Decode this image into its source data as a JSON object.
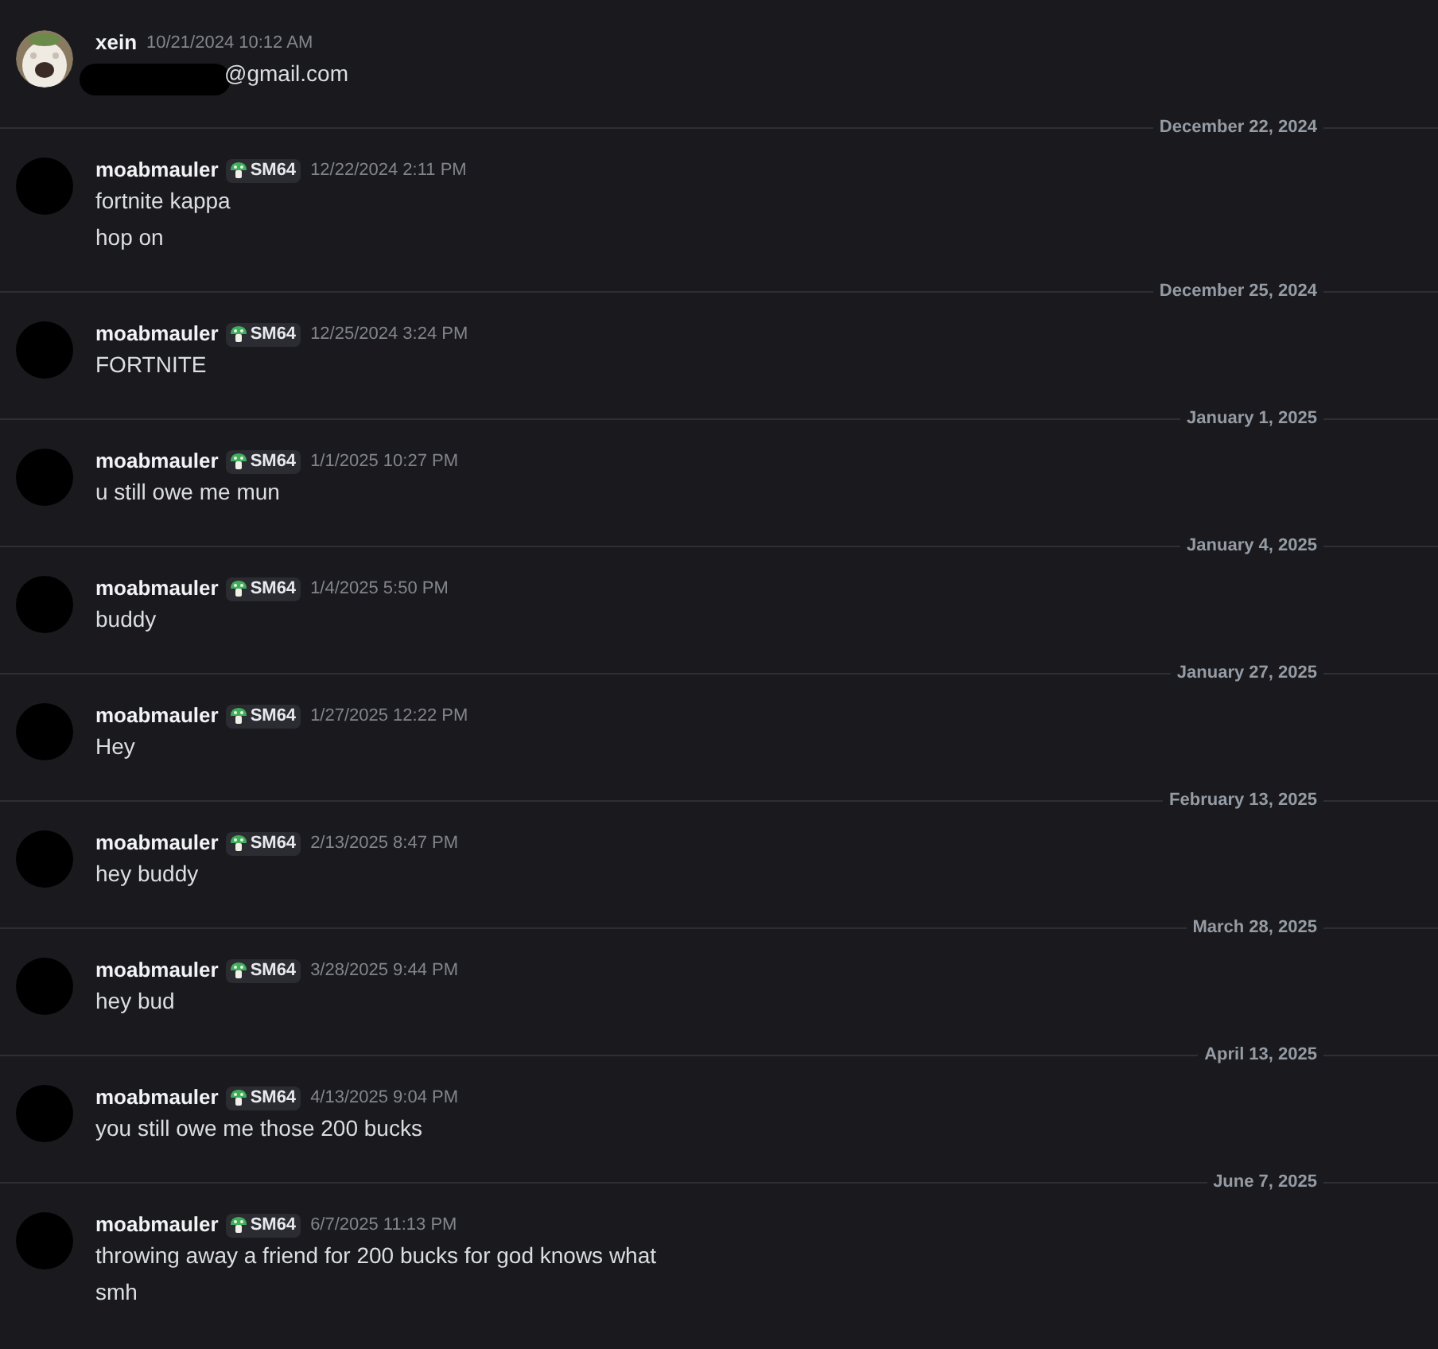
{
  "messages": [
    {
      "author": "xein",
      "avatar": {
        "kind": "picture"
      },
      "timestamp": "10/21/2024 10:12 AM",
      "redacted": true,
      "lines": [
        "@gmail.com"
      ]
    },
    {
      "date_divider": "December 22, 2024",
      "author": "moabmauler",
      "avatar": {
        "kind": "blank"
      },
      "tag": "SM64",
      "timestamp": "12/22/2024 2:11 PM",
      "redacted": false,
      "lines": [
        "fortnite kappa",
        "hop on"
      ]
    },
    {
      "date_divider": "December 25, 2024",
      "author": "moabmauler",
      "avatar": {
        "kind": "blank"
      },
      "tag": "SM64",
      "timestamp": "12/25/2024 3:24 PM",
      "redacted": false,
      "lines": [
        "FORTNITE"
      ]
    },
    {
      "date_divider": "January 1, 2025",
      "author": "moabmauler",
      "avatar": {
        "kind": "blank"
      },
      "tag": "SM64",
      "timestamp": "1/1/2025 10:27 PM",
      "redacted": false,
      "lines": [
        "u still owe me mun"
      ]
    },
    {
      "date_divider": "January 4, 2025",
      "author": "moabmauler",
      "avatar": {
        "kind": "blank"
      },
      "tag": "SM64",
      "timestamp": "1/4/2025 5:50 PM",
      "redacted": false,
      "lines": [
        "buddy"
      ]
    },
    {
      "date_divider": "January 27, 2025",
      "author": "moabmauler",
      "avatar": {
        "kind": "blank"
      },
      "tag": "SM64",
      "timestamp": "1/27/2025 12:22 PM",
      "redacted": false,
      "lines": [
        "Hey"
      ]
    },
    {
      "date_divider": "February 13, 2025",
      "author": "moabmauler",
      "avatar": {
        "kind": "blank"
      },
      "tag": "SM64",
      "timestamp": "2/13/2025 8:47 PM",
      "redacted": false,
      "lines": [
        "hey buddy"
      ]
    },
    {
      "date_divider": "March 28, 2025",
      "author": "moabmauler",
      "avatar": {
        "kind": "blank"
      },
      "tag": "SM64",
      "timestamp": "3/28/2025 9:44 PM",
      "redacted": false,
      "lines": [
        "hey bud"
      ]
    },
    {
      "date_divider": "April 13, 2025",
      "author": "moabmauler",
      "avatar": {
        "kind": "blank"
      },
      "tag": "SM64",
      "timestamp": "4/13/2025 9:04 PM",
      "redacted": false,
      "lines": [
        "you still owe me those 200 bucks"
      ]
    },
    {
      "date_divider": "June 7, 2025",
      "author": "moabmauler",
      "avatar": {
        "kind": "blank"
      },
      "tag": "SM64",
      "timestamp": "6/7/2025 11:13 PM",
      "redacted": false,
      "lines": [
        "throwing away a friend for 200 bucks for god knows what",
        "smh"
      ]
    }
  ]
}
